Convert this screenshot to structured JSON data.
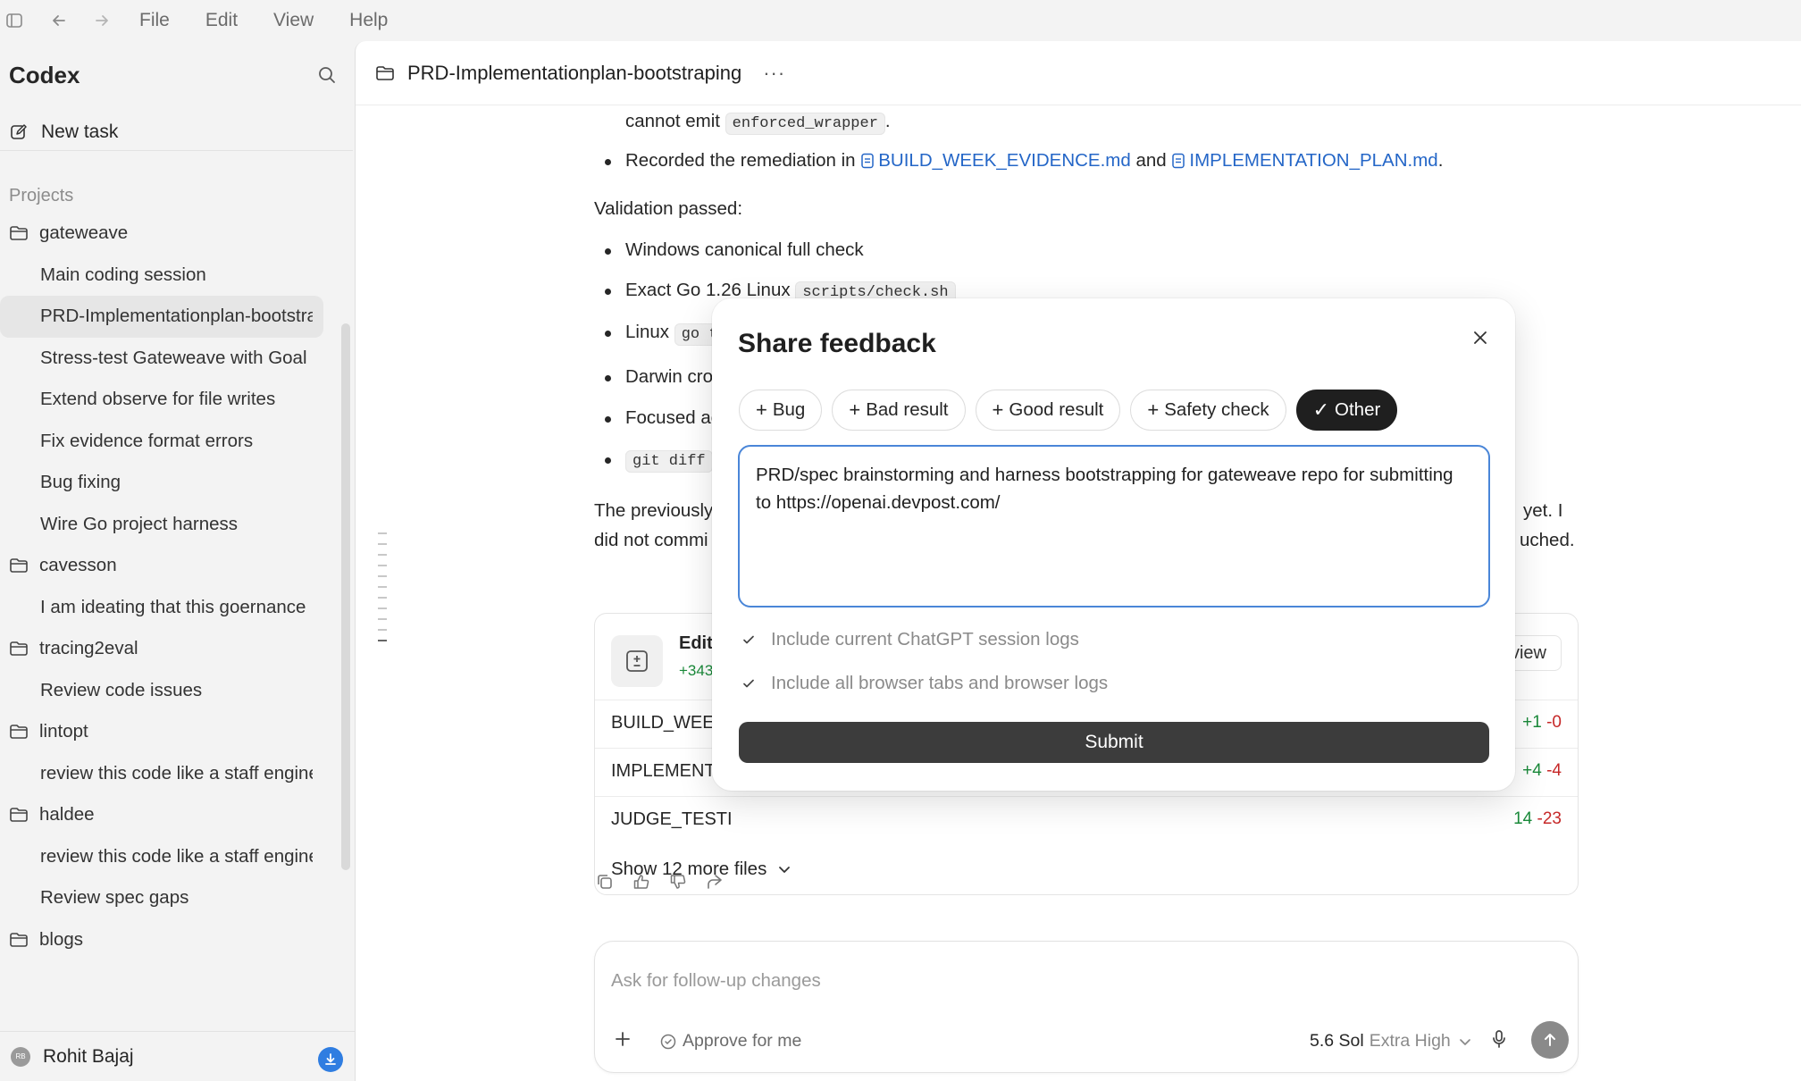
{
  "menubar": {
    "items": [
      "File",
      "Edit",
      "View",
      "Help"
    ]
  },
  "sidebar": {
    "app_title": "Codex",
    "new_task_label": "New task",
    "projects_label": "Projects",
    "items": [
      {
        "type": "project",
        "label": "gateweave"
      },
      {
        "type": "task",
        "label": "Main coding session"
      },
      {
        "type": "task",
        "label": "PRD-Implementationplan-bootstraping",
        "active": true
      },
      {
        "type": "task",
        "label": "Stress-test Gateweave with Goal"
      },
      {
        "type": "task",
        "label": "Extend observe for file writes"
      },
      {
        "type": "task",
        "label": "Fix evidence format errors"
      },
      {
        "type": "task",
        "label": "Bug fixing"
      },
      {
        "type": "task",
        "label": "Wire Go project harness"
      },
      {
        "type": "project",
        "label": "cavesson"
      },
      {
        "type": "task",
        "label": "I am ideating that this goernance"
      },
      {
        "type": "project",
        "label": "tracing2eval"
      },
      {
        "type": "task",
        "label": "Review code issues"
      },
      {
        "type": "project",
        "label": "lintopt"
      },
      {
        "type": "task",
        "label": "review this code like a staff engineer"
      },
      {
        "type": "project",
        "label": "haldee"
      },
      {
        "type": "task",
        "label": "review this code like a staff engineer"
      },
      {
        "type": "task",
        "label": "Review spec gaps"
      },
      {
        "type": "project",
        "label": "blogs"
      }
    ],
    "user": {
      "initials": "RB",
      "name": "Rohit Bajaj"
    }
  },
  "main": {
    "title": "PRD-Implementationplan-bootstraping",
    "more": "···",
    "line1_text": "cannot emit ",
    "line1_code": "enforced_wrapper",
    "line1_end": ".",
    "line2_text": "Recorded the remediation in ",
    "line2_link1": "BUILD_WEEK_EVIDENCE.md",
    "line2_and": " and ",
    "line2_link2": "IMPLEMENTATION_PLAN.md",
    "line2_end": ".",
    "validation_label": "Validation passed:",
    "checks": [
      {
        "text": "Windows canonical full check"
      },
      {
        "text": "Exact Go 1.26 Linux ",
        "code": "scripts/check.sh"
      },
      {
        "text": "Linux ",
        "code": "go t"
      },
      {
        "text": "Darwin cro"
      },
      {
        "text": "Focused ac"
      },
      {
        "text": "",
        "code": "git diff"
      }
    ],
    "para_left_1": "The previously",
    "para_left_2": "did not commi",
    "para_right_1": "yet. I",
    "para_right_2": "uched.",
    "edited": {
      "title": "Edite",
      "stats": "+343",
      "review_label": "view",
      "files": [
        {
          "name": "BUILD_WEEK",
          "added": "+1",
          "removed": "-0"
        },
        {
          "name": "IMPLEMENTA",
          "added": "+4",
          "removed": "-4"
        },
        {
          "name": "JUDGE_TESTI",
          "added": "14",
          "removed": "-23"
        }
      ],
      "show_more": "Show 12 more files"
    },
    "composer": {
      "placeholder": "Ask for follow-up changes",
      "approve_label": "Approve for me",
      "model": "5.6 Sol",
      "effort": "Extra High"
    }
  },
  "modal": {
    "title": "Share feedback",
    "chips": [
      {
        "prefix": "+",
        "label": "Bug",
        "selected": false
      },
      {
        "prefix": "+",
        "label": "Bad result",
        "selected": false
      },
      {
        "prefix": "+",
        "label": "Good result",
        "selected": false
      },
      {
        "prefix": "+",
        "label": "Safety check",
        "selected": false
      },
      {
        "prefix": "✓",
        "label": "Other",
        "selected": true
      }
    ],
    "feedback_text": "PRD/spec brainstorming and harness bootstrapping for gateweave repo for submitting to https://openai.devpost.com/",
    "include_session_logs": {
      "label": "Include current ChatGPT session logs",
      "checked": true
    },
    "include_browser_logs": {
      "label": "Include all browser tabs and browser logs",
      "checked": true
    },
    "submit_label": "Submit"
  }
}
